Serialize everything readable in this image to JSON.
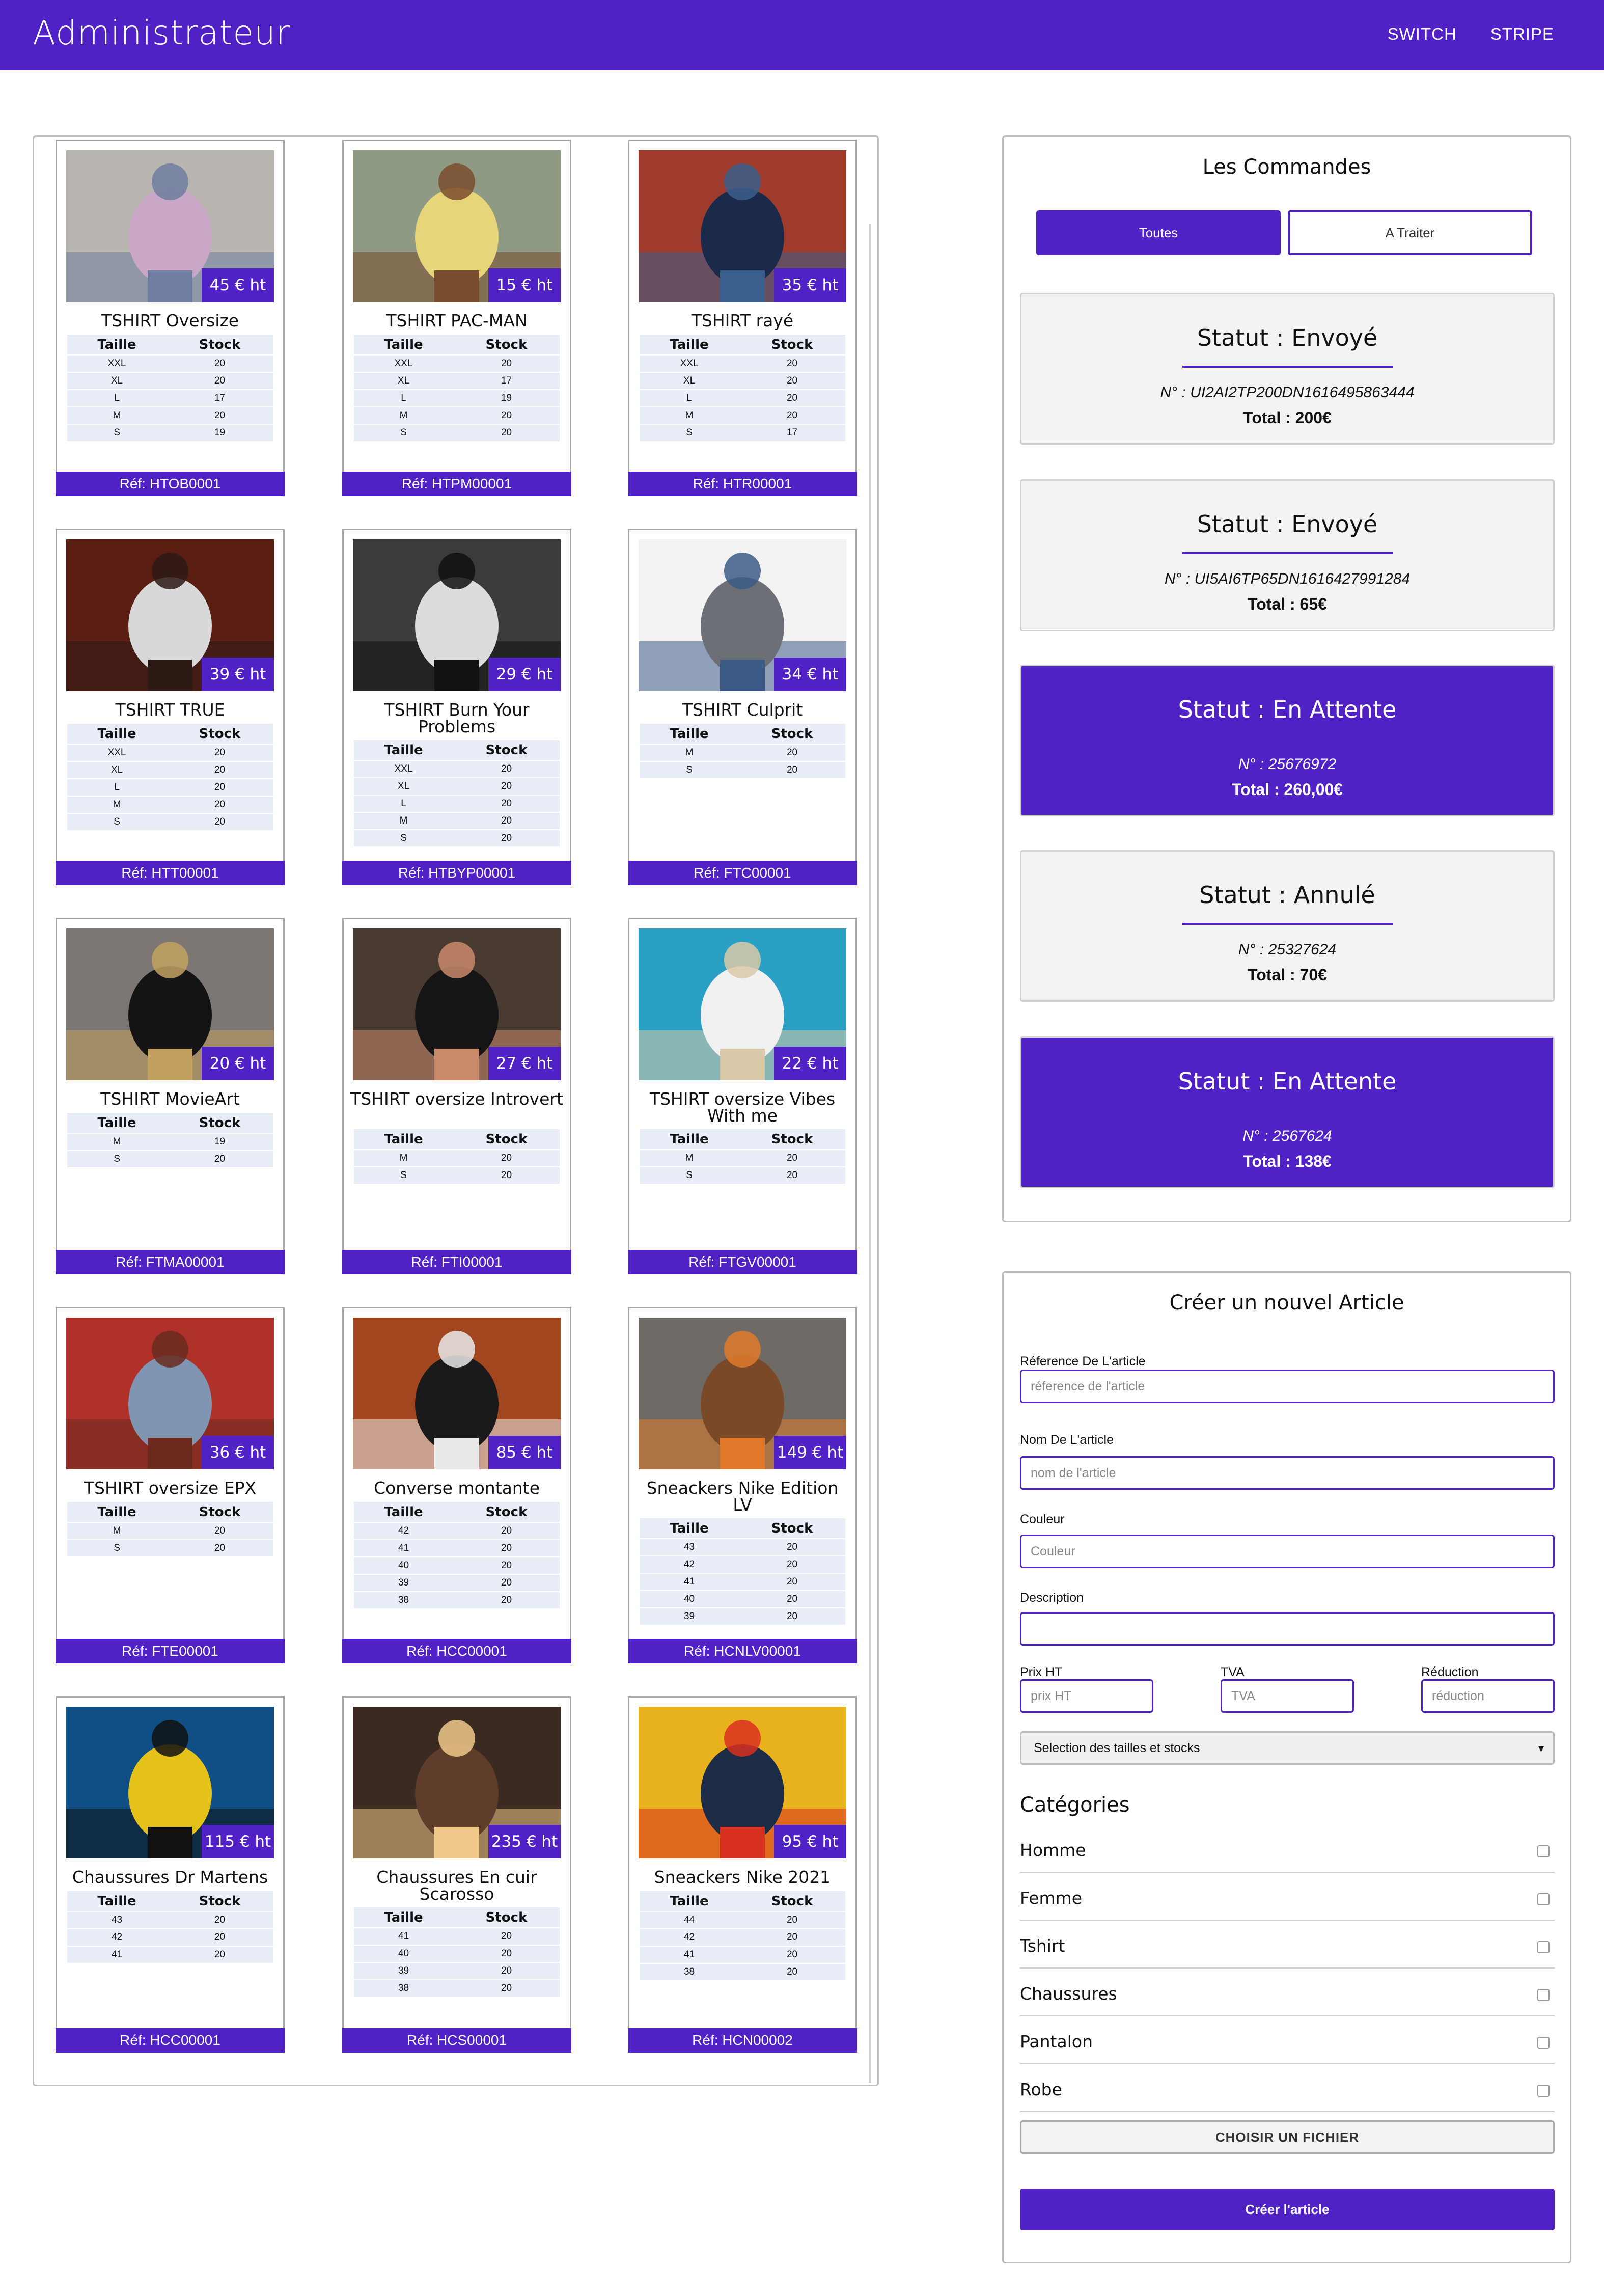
{
  "header": {
    "title": "Administrateur",
    "nav": [
      "SWITCH",
      "STRIPE"
    ]
  },
  "products": [
    {
      "name": "TSHIRT Oversize",
      "price": "45 € ht",
      "ref": "Réf: HTOB0001",
      "image": "man-bridge-photo",
      "table_head": [
        "Taille",
        "Stock"
      ],
      "rows": [
        [
          "XXL",
          "20"
        ],
        [
          "XL",
          "20"
        ],
        [
          "L",
          "17"
        ],
        [
          "M",
          "20"
        ],
        [
          "S",
          "19"
        ]
      ],
      "colors": {
        "bg": "#b9b5b0",
        "fig": "#caa7c6",
        "accent": "#6f7ea0"
      }
    },
    {
      "name": "TSHIRT PAC-MAN",
      "price": "15 € ht",
      "ref": "Réf: HTPM00001",
      "image": "pacman-shirt-photo",
      "table_head": [
        "Taille",
        "Stock"
      ],
      "rows": [
        [
          "XXL",
          "20"
        ],
        [
          "XL",
          "17"
        ],
        [
          "L",
          "19"
        ],
        [
          "M",
          "20"
        ],
        [
          "S",
          "20"
        ]
      ],
      "colors": {
        "bg": "#8f9a84",
        "fig": "#e7d57a",
        "accent": "#7a4c2e"
      }
    },
    {
      "name": "TSHIRT rayé",
      "price": "35 € ht",
      "ref": "Réf: HTR00001",
      "image": "striped-shirt-photo",
      "table_head": [
        "Taille",
        "Stock"
      ],
      "rows": [
        [
          "XXL",
          "20"
        ],
        [
          "XL",
          "20"
        ],
        [
          "L",
          "20"
        ],
        [
          "M",
          "20"
        ],
        [
          "S",
          "17"
        ]
      ],
      "colors": {
        "bg": "#9e3b2c",
        "fig": "#1b2a4a",
        "accent": "#3a5f8c"
      }
    },
    {
      "name": "TSHIRT TRUE",
      "price": "39 € ht",
      "ref": "Réf: HTT00001",
      "image": "dark-room-photo",
      "table_head": [
        "Taille",
        "Stock"
      ],
      "rows": [
        [
          "XXL",
          "20"
        ],
        [
          "XL",
          "20"
        ],
        [
          "L",
          "20"
        ],
        [
          "M",
          "20"
        ],
        [
          "S",
          "20"
        ]
      ],
      "colors": {
        "bg": "#5a1e12",
        "fig": "#d8d8d8",
        "accent": "#2d1a15"
      }
    },
    {
      "name": "TSHIRT Burn Your Problems",
      "price": "29 € ht",
      "ref": "Réf: HTBYP00001",
      "image": "burn-shirt-photo",
      "table_head": [
        "Taille",
        "Stock"
      ],
      "rows": [
        [
          "XXL",
          "20"
        ],
        [
          "XL",
          "20"
        ],
        [
          "L",
          "20"
        ],
        [
          "M",
          "20"
        ],
        [
          "S",
          "20"
        ]
      ],
      "colors": {
        "bg": "#3b3b3b",
        "fig": "#dcdcdc",
        "accent": "#111111"
      }
    },
    {
      "name": "TSHIRT Culprit",
      "price": "34 € ht",
      "ref": "Réf: FTC00001",
      "image": "woman-white-photo",
      "table_head": [
        "Taille",
        "Stock"
      ],
      "rows": [
        [
          "M",
          "20"
        ],
        [
          "S",
          "20"
        ]
      ],
      "colors": {
        "bg": "#f3f3f3",
        "fig": "#6c7076",
        "accent": "#3c5a86"
      }
    },
    {
      "name": "TSHIRT MovieArt",
      "price": "20 € ht",
      "ref": "Réf: FTMA00001",
      "image": "movieart-shirt-photo",
      "table_head": [
        "Taille",
        "Stock"
      ],
      "rows": [
        [
          "M",
          "19"
        ],
        [
          "S",
          "20"
        ]
      ],
      "colors": {
        "bg": "#7d7773",
        "fig": "#141414",
        "accent": "#c2a060"
      }
    },
    {
      "name": "TSHIRT oversize Introvert",
      "price": "27 € ht",
      "ref": "Réf: FTI00001",
      "image": "introvert-shirt-photo",
      "table_head": [
        "Taille",
        "Stock"
      ],
      "rows": [
        [
          "M",
          "20"
        ],
        [
          "S",
          "20"
        ]
      ],
      "colors": {
        "bg": "#4a3b32",
        "fig": "#151515",
        "accent": "#c98a6b"
      }
    },
    {
      "name": "TSHIRT oversize Vibes With me",
      "price": "22 € ht",
      "ref": "Réf: FTGV00001",
      "image": "beach-photo",
      "table_head": [
        "Taille",
        "Stock"
      ],
      "rows": [
        [
          "M",
          "20"
        ],
        [
          "S",
          "20"
        ]
      ],
      "colors": {
        "bg": "#2aa1c4",
        "fig": "#f1f1f1",
        "accent": "#d9c9a8"
      }
    },
    {
      "name": "TSHIRT oversize EPX",
      "price": "36 € ht",
      "ref": "Réf: FTE00001",
      "image": "red-wall-photo",
      "table_head": [
        "Taille",
        "Stock"
      ],
      "rows": [
        [
          "M",
          "20"
        ],
        [
          "S",
          "20"
        ]
      ],
      "colors": {
        "bg": "#b0302a",
        "fig": "#8095b2",
        "accent": "#6a2a1e"
      }
    },
    {
      "name": "Converse montante",
      "price": "85 € ht",
      "ref": "Réf: HCC00001",
      "image": "converse-photo",
      "table_head": [
        "Taille",
        "Stock"
      ],
      "rows": [
        [
          "42",
          "20"
        ],
        [
          "41",
          "20"
        ],
        [
          "40",
          "20"
        ],
        [
          "39",
          "20"
        ],
        [
          "38",
          "20"
        ]
      ],
      "colors": {
        "bg": "#a2461f",
        "fig": "#1a1a1a",
        "accent": "#e9e9e9"
      }
    },
    {
      "name": "Sneackers Nike Edition LV",
      "price": "149 € ht",
      "ref": "Réf: HCNLV00001",
      "image": "nike-lv-photo",
      "table_head": [
        "Taille",
        "Stock"
      ],
      "rows": [
        [
          "43",
          "20"
        ],
        [
          "42",
          "20"
        ],
        [
          "41",
          "20"
        ],
        [
          "40",
          "20"
        ],
        [
          "39",
          "20"
        ]
      ],
      "colors": {
        "bg": "#6e6b67",
        "fig": "#7a4a28",
        "accent": "#e07a2a"
      }
    },
    {
      "name": "Chaussures Dr Martens",
      "price": "115 € ht",
      "ref": "Réf: HCC00001",
      "image": "dr-martens-photo",
      "table_head": [
        "Taille",
        "Stock"
      ],
      "rows": [
        [
          "43",
          "20"
        ],
        [
          "42",
          "20"
        ],
        [
          "41",
          "20"
        ]
      ],
      "colors": {
        "bg": "#0f4f86",
        "fig": "#e4c21a",
        "accent": "#111111"
      }
    },
    {
      "name": "Chaussures En cuir Scarosso",
      "price": "235 € ht",
      "ref": "Réf: HCS00001",
      "image": "leather-shoes-photo",
      "table_head": [
        "Taille",
        "Stock"
      ],
      "rows": [
        [
          "41",
          "20"
        ],
        [
          "40",
          "20"
        ],
        [
          "39",
          "20"
        ],
        [
          "38",
          "20"
        ]
      ],
      "colors": {
        "bg": "#3a2a22",
        "fig": "#5e3d2a",
        "accent": "#f0c88a"
      }
    },
    {
      "name": "Sneackers Nike 2021",
      "price": "95 € ht",
      "ref": "Réf: HCN00002",
      "image": "nike-2021-photo",
      "table_head": [
        "Taille",
        "Stock"
      ],
      "rows": [
        [
          "44",
          "20"
        ],
        [
          "42",
          "20"
        ],
        [
          "41",
          "20"
        ],
        [
          "38",
          "20"
        ]
      ],
      "colors": {
        "bg": "#e8b21e",
        "fig": "#1c2b46",
        "accent": "#d8301f"
      }
    }
  ],
  "orders": {
    "title": "Les Commandes",
    "tabs": [
      "Toutes",
      "A Traiter"
    ],
    "items": [
      {
        "status": "Statut : Envoyé",
        "number": "N° : UI2AI2TP200DN1616495863444",
        "total": "Total : 200€",
        "style": "grey"
      },
      {
        "status": "Statut : Envoyé",
        "number": "N° : UI5AI6TP65DN1616427991284",
        "total": "Total : 65€",
        "style": "grey"
      },
      {
        "status": "Statut : En Attente",
        "number": "N° : 25676972",
        "total": "Total : 260,00€",
        "style": "purple"
      },
      {
        "status": "Statut : Annulé",
        "number": "N° : 25327624",
        "total": "Total : 70€",
        "style": "grey"
      },
      {
        "status": "Statut : En Attente",
        "number": "N° : 2567624",
        "total": "Total : 138€",
        "style": "purple"
      }
    ]
  },
  "form": {
    "title": "Créer un nouvel Article",
    "ref_label": "Réference De L'article",
    "ref_placeholder": "réference de l'article",
    "name_label": "Nom De L'article",
    "name_placeholder": "nom de l'article",
    "color_label": "Couleur",
    "color_placeholder": "Couleur",
    "desc_label": "Description",
    "price_label": "Prix HT",
    "price_placeholder": "prix HT",
    "tva_label": "TVA",
    "tva_placeholder": "TVA",
    "reduction_label": "Réduction",
    "reduction_placeholder": "réduction",
    "select_value": "Selection des tailles et stocks",
    "categories_title": "Catégories",
    "categories": [
      "Homme",
      "Femme",
      "Tshirt",
      "Chaussures",
      "Pantalon",
      "Robe"
    ],
    "file_button": "CHOISIR UN FICHIER",
    "submit_button": "Créer l'article"
  },
  "accent_color": "#5022c6"
}
